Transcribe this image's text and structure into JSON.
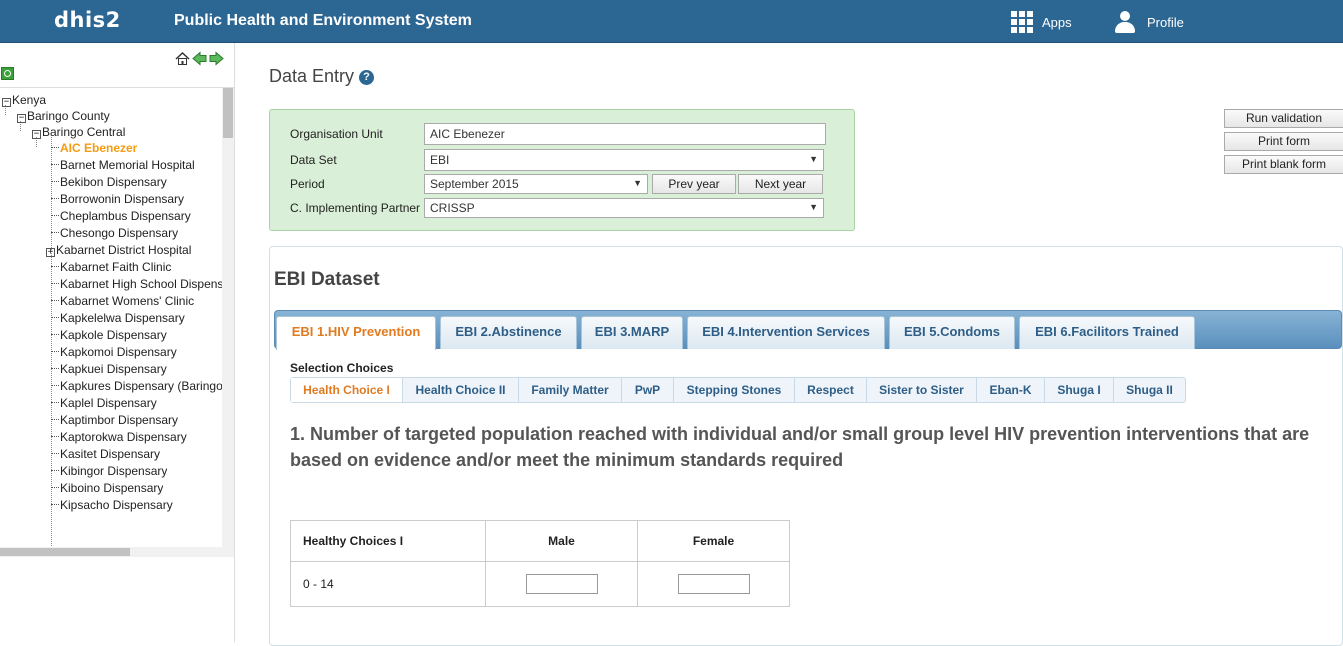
{
  "header": {
    "logo": "dhis2",
    "title": "Public Health and Environment System",
    "apps_label": "Apps",
    "profile_label": "Profile"
  },
  "tree": {
    "root": "Kenya",
    "county": "Baringo County",
    "subcounty": "Baringo Central",
    "selected": "AIC Ebenezer",
    "items": [
      "Barnet Memorial Hospital",
      "Bekibon Dispensary",
      "Borrowonin Dispensary",
      "Cheplambus Dispensary",
      "Chesongo Dispensary",
      "Kabarnet District Hospital",
      "Kabarnet Faith Clinic",
      "Kabarnet High School Dispens",
      "Kabarnet Womens' Clinic",
      "Kapkelelwa Dispensary",
      "Kapkole Dispensary",
      "Kapkomoi Dispensary",
      "Kapkuei Dispensary",
      "Kapkures Dispensary (Baringo",
      "Kaplel Dispensary",
      "Kaptimbor Dispensary",
      "Kaptorokwa Dispensary",
      "Kasitet Dispensary",
      "Kibingor Dispensary",
      "Kiboino Dispensary",
      "Kipsacho Dispensary"
    ]
  },
  "page": {
    "title": "Data Entry"
  },
  "selection": {
    "org_unit_label": "Organisation Unit",
    "org_unit_value": "AIC Ebenezer",
    "dataset_label": "Data Set",
    "dataset_value": "EBI",
    "period_label": "Period",
    "period_value": "September 2015",
    "prev_year": "Prev year",
    "next_year": "Next year",
    "partner_label": "C. Implementing Partner",
    "partner_value": "CRISSP"
  },
  "actions": {
    "run_validation": "Run validation",
    "print_form": "Print form",
    "print_blank_form": "Print blank form"
  },
  "form": {
    "title": "EBI Dataset",
    "tabs": [
      "EBI 1.HIV Prevention",
      "EBI 2.Abstinence",
      "EBI 3.MARP",
      "EBI 4.Intervention Services",
      "EBI 5.Condoms",
      "EBI 6.Facilitors Trained"
    ],
    "selection_choices_label": "Selection Choices",
    "subtabs": [
      "Health Choice I",
      "Health Choice II",
      "Family Matter",
      "PwP",
      "Stepping Stones",
      "Respect",
      "Sister to Sister",
      "Eban-K",
      "Shuga I",
      "Shuga II"
    ],
    "question": "1. Number of targeted population reached with individual and/or small group level HIV prevention interventions that are based on evidence and/or meet the minimum standards required",
    "table": {
      "header": [
        "Healthy Choices I",
        "Male",
        "Female"
      ],
      "row_label": "0 - 14"
    }
  },
  "colors": {
    "header_bg": "#2c6693",
    "selection_bg": "#d9efd7",
    "active_tab_text": "#e07b22",
    "tab_text": "#2e5e87"
  }
}
